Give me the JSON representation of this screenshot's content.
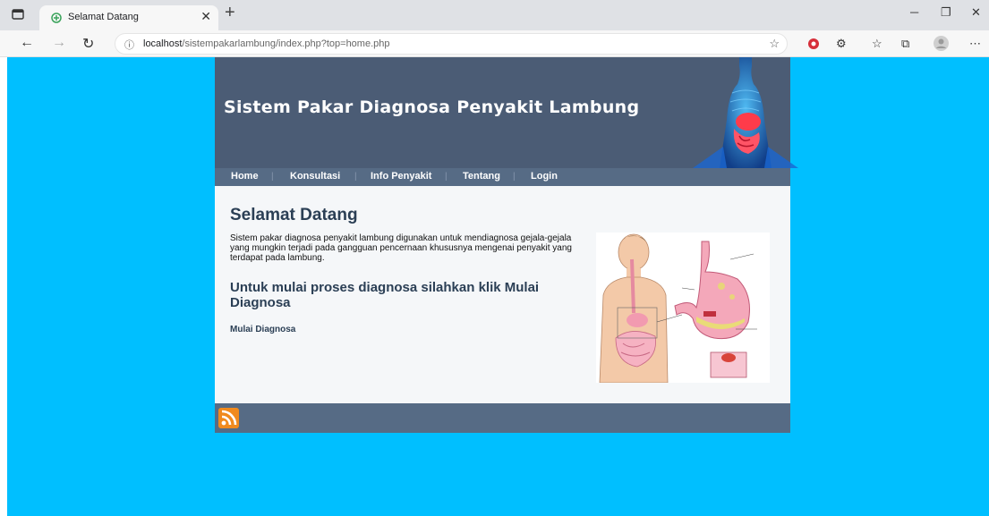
{
  "browser": {
    "tab_title": "Selamat Datang",
    "url_host": "localhost",
    "url_path": "/sistempakarlambung/index.php?top=home.php"
  },
  "site": {
    "title": "Sistem Pakar Diagnosa Penyakit Lambung",
    "menu": [
      "Home",
      "Konsultasi",
      "Info Penyakit",
      "Tentang",
      "Login"
    ],
    "heading": "Selamat Datang",
    "intro": "Sistem pakar diagnosa penyakit lambung digunakan untuk mendiagnosa gejala-gejala yang mungkin terjadi pada gangguan pencernaan khususnya mengenai penyakit yang terdapat pada lambung.",
    "subheading": "Untuk mulai proses diagnosa silahkan klik Mulai Diagnosa",
    "cta": "Mulai Diagnosa"
  },
  "colors": {
    "background": "#00bfff",
    "header": "#4b5c75",
    "menu": "#566b85",
    "content": "#f5f7f9",
    "heading_text": "#2b3f55"
  }
}
